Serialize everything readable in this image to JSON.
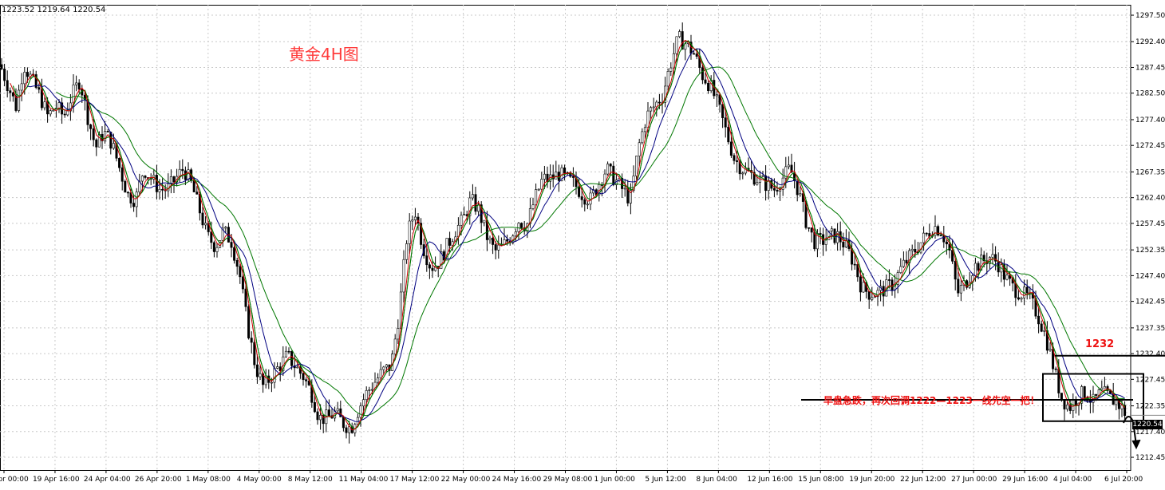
{
  "ohlc_readout": "1223.52 1219.64 1220.54",
  "chart_data": {
    "type": "candlestick",
    "title": "黄金4H图",
    "ylim": [
      1210,
      1300
    ],
    "y_ticks": [
      "1297.50",
      "1292.40",
      "1287.45",
      "1282.50",
      "1277.40",
      "1272.45",
      "1267.35",
      "1262.40",
      "1257.45",
      "1252.35",
      "1247.40",
      "1242.45",
      "1237.35",
      "1232.40",
      "1227.45",
      "1222.35",
      "1217.40",
      "1212.45"
    ],
    "x_ticks": [
      "17 Apr 00:00",
      "19 Apr 16:00",
      "24 Apr 04:00",
      "26 Apr 20:00",
      "1 May 08:00",
      "4 May 00:00",
      "8 May 12:00",
      "11 May 04:00",
      "17 May 12:00",
      "22 May 00:00",
      "24 May 16:00",
      "29 May 08:00",
      "1 Jun 00:00",
      "5 Jun 12:00",
      "8 Jun 04:00",
      "12 Jun 16:00",
      "15 Jun 08:00",
      "19 Jun 20:00",
      "22 Jun 12:00",
      "27 Jun 00:00",
      "29 Jun 16:00",
      "4 Jul 04:00",
      "6 Jul 20:00"
    ],
    "current_price": "1220.54",
    "close_path": [
      {
        "x": 0,
        "y": 1288
      },
      {
        "x": 10,
        "y": 1284
      },
      {
        "x": 20,
        "y": 1280
      },
      {
        "x": 30,
        "y": 1288
      },
      {
        "x": 40,
        "y": 1285
      },
      {
        "x": 50,
        "y": 1282
      },
      {
        "x": 60,
        "y": 1278
      },
      {
        "x": 70,
        "y": 1280
      },
      {
        "x": 80,
        "y": 1278
      },
      {
        "x": 90,
        "y": 1282
      },
      {
        "x": 100,
        "y": 1285
      },
      {
        "x": 110,
        "y": 1278
      },
      {
        "x": 120,
        "y": 1272
      },
      {
        "x": 130,
        "y": 1275
      },
      {
        "x": 140,
        "y": 1273
      },
      {
        "x": 150,
        "y": 1268
      },
      {
        "x": 160,
        "y": 1263
      },
      {
        "x": 170,
        "y": 1262
      },
      {
        "x": 180,
        "y": 1268
      },
      {
        "x": 190,
        "y": 1266
      },
      {
        "x": 200,
        "y": 1264
      },
      {
        "x": 210,
        "y": 1264
      },
      {
        "x": 220,
        "y": 1266
      },
      {
        "x": 230,
        "y": 1268
      },
      {
        "x": 240,
        "y": 1265
      },
      {
        "x": 250,
        "y": 1260
      },
      {
        "x": 260,
        "y": 1255
      },
      {
        "x": 270,
        "y": 1253
      },
      {
        "x": 280,
        "y": 1256
      },
      {
        "x": 290,
        "y": 1254
      },
      {
        "x": 300,
        "y": 1248
      },
      {
        "x": 310,
        "y": 1238
      },
      {
        "x": 320,
        "y": 1230
      },
      {
        "x": 330,
        "y": 1226
      },
      {
        "x": 340,
        "y": 1228
      },
      {
        "x": 350,
        "y": 1230
      },
      {
        "x": 360,
        "y": 1232
      },
      {
        "x": 370,
        "y": 1230
      },
      {
        "x": 380,
        "y": 1228
      },
      {
        "x": 390,
        "y": 1225
      },
      {
        "x": 400,
        "y": 1220
      },
      {
        "x": 410,
        "y": 1220
      },
      {
        "x": 420,
        "y": 1221
      },
      {
        "x": 430,
        "y": 1219
      },
      {
        "x": 440,
        "y": 1218
      },
      {
        "x": 450,
        "y": 1222
      },
      {
        "x": 460,
        "y": 1225
      },
      {
        "x": 470,
        "y": 1227
      },
      {
        "x": 480,
        "y": 1229
      },
      {
        "x": 490,
        "y": 1230
      },
      {
        "x": 500,
        "y": 1240
      },
      {
        "x": 510,
        "y": 1255
      },
      {
        "x": 520,
        "y": 1260
      },
      {
        "x": 530,
        "y": 1253
      },
      {
        "x": 540,
        "y": 1249
      },
      {
        "x": 550,
        "y": 1250
      },
      {
        "x": 560,
        "y": 1253
      },
      {
        "x": 570,
        "y": 1256
      },
      {
        "x": 580,
        "y": 1258
      },
      {
        "x": 590,
        "y": 1262
      },
      {
        "x": 600,
        "y": 1260
      },
      {
        "x": 610,
        "y": 1255
      },
      {
        "x": 620,
        "y": 1252
      },
      {
        "x": 630,
        "y": 1253
      },
      {
        "x": 640,
        "y": 1255
      },
      {
        "x": 650,
        "y": 1258
      },
      {
        "x": 660,
        "y": 1257
      },
      {
        "x": 670,
        "y": 1262
      },
      {
        "x": 680,
        "y": 1266
      },
      {
        "x": 690,
        "y": 1266
      },
      {
        "x": 700,
        "y": 1267
      },
      {
        "x": 710,
        "y": 1266
      },
      {
        "x": 720,
        "y": 1265
      },
      {
        "x": 730,
        "y": 1263
      },
      {
        "x": 740,
        "y": 1262
      },
      {
        "x": 750,
        "y": 1265
      },
      {
        "x": 760,
        "y": 1268
      },
      {
        "x": 770,
        "y": 1266
      },
      {
        "x": 780,
        "y": 1264
      },
      {
        "x": 790,
        "y": 1262
      },
      {
        "x": 800,
        "y": 1272
      },
      {
        "x": 810,
        "y": 1278
      },
      {
        "x": 820,
        "y": 1280
      },
      {
        "x": 830,
        "y": 1282
      },
      {
        "x": 840,
        "y": 1288
      },
      {
        "x": 850,
        "y": 1293
      },
      {
        "x": 860,
        "y": 1292
      },
      {
        "x": 870,
        "y": 1290
      },
      {
        "x": 880,
        "y": 1286
      },
      {
        "x": 890,
        "y": 1284
      },
      {
        "x": 900,
        "y": 1280
      },
      {
        "x": 910,
        "y": 1275
      },
      {
        "x": 920,
        "y": 1270
      },
      {
        "x": 930,
        "y": 1268
      },
      {
        "x": 940,
        "y": 1267
      },
      {
        "x": 950,
        "y": 1266
      },
      {
        "x": 960,
        "y": 1265
      },
      {
        "x": 970,
        "y": 1264
      },
      {
        "x": 980,
        "y": 1266
      },
      {
        "x": 990,
        "y": 1268
      },
      {
        "x": 1000,
        "y": 1264
      },
      {
        "x": 1010,
        "y": 1258
      },
      {
        "x": 1020,
        "y": 1254
      },
      {
        "x": 1030,
        "y": 1254
      },
      {
        "x": 1040,
        "y": 1255
      },
      {
        "x": 1050,
        "y": 1255
      },
      {
        "x": 1060,
        "y": 1253
      },
      {
        "x": 1070,
        "y": 1250
      },
      {
        "x": 1080,
        "y": 1245
      },
      {
        "x": 1090,
        "y": 1244
      },
      {
        "x": 1100,
        "y": 1244
      },
      {
        "x": 1110,
        "y": 1245
      },
      {
        "x": 1120,
        "y": 1246
      },
      {
        "x": 1130,
        "y": 1249
      },
      {
        "x": 1140,
        "y": 1251
      },
      {
        "x": 1150,
        "y": 1253
      },
      {
        "x": 1160,
        "y": 1255
      },
      {
        "x": 1170,
        "y": 1257
      },
      {
        "x": 1180,
        "y": 1256
      },
      {
        "x": 1190,
        "y": 1252
      },
      {
        "x": 1200,
        "y": 1244
      },
      {
        "x": 1210,
        "y": 1246
      },
      {
        "x": 1220,
        "y": 1249
      },
      {
        "x": 1230,
        "y": 1250
      },
      {
        "x": 1240,
        "y": 1251
      },
      {
        "x": 1250,
        "y": 1250
      },
      {
        "x": 1260,
        "y": 1247
      },
      {
        "x": 1270,
        "y": 1245
      },
      {
        "x": 1280,
        "y": 1244
      },
      {
        "x": 1290,
        "y": 1243
      },
      {
        "x": 1300,
        "y": 1240
      },
      {
        "x": 1310,
        "y": 1236
      },
      {
        "x": 1320,
        "y": 1230
      },
      {
        "x": 1330,
        "y": 1224
      },
      {
        "x": 1340,
        "y": 1222
      },
      {
        "x": 1350,
        "y": 1224
      },
      {
        "x": 1360,
        "y": 1225
      },
      {
        "x": 1370,
        "y": 1223
      },
      {
        "x": 1380,
        "y": 1225
      },
      {
        "x": 1390,
        "y": 1224
      },
      {
        "x": 1400,
        "y": 1223
      },
      {
        "x": 1410,
        "y": 1221
      }
    ],
    "ma_fast_color": "#cc0000",
    "ma_mid_color": "#000080",
    "ma_slow_color": "#007700",
    "candle_color": "#000000"
  },
  "annotations": {
    "level_label": "1232",
    "level_value": 1232,
    "note": "早盘急跌，再次回调1222—1223一线先空一把！",
    "note_line_value": 1223.5,
    "box_top_value": 1228.5,
    "box_bottom_value": 1219.4
  }
}
